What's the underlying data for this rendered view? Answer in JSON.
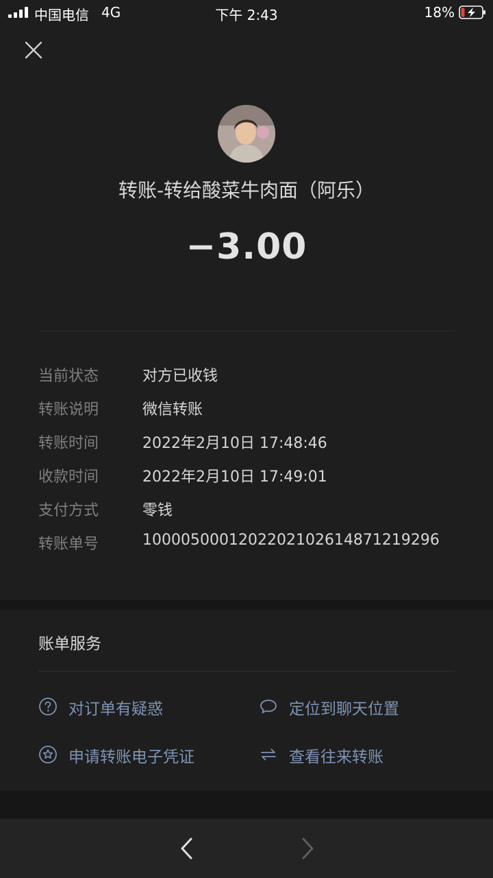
{
  "status_bar": {
    "carrier": "中国电信",
    "network": "4G",
    "time": "下午 2:43",
    "battery": "18%"
  },
  "header": {
    "close_icon": "close-icon",
    "title": "转账-转给酸菜牛肉面（阿乐）",
    "amount": "−3.00"
  },
  "details": [
    {
      "label": "当前状态",
      "value": "对方已收钱"
    },
    {
      "label": "转账说明",
      "value": "微信转账"
    },
    {
      "label": "转账时间",
      "value": "2022年2月10日 17:48:46"
    },
    {
      "label": "收款时间",
      "value": "2022年2月10日 17:49:01"
    },
    {
      "label": "支付方式",
      "value": "零钱"
    },
    {
      "label": "转账单号",
      "value": "100005000120220210261487121929 6"
    }
  ],
  "services": {
    "title": "账单服务",
    "items": [
      {
        "label": "对订单有疑惑",
        "icon": "question-icon"
      },
      {
        "label": "定位到聊天位置",
        "icon": "chat-bubble-icon"
      },
      {
        "label": "申请转账电子凭证",
        "icon": "star-icon"
      },
      {
        "label": "查看往来转账",
        "icon": "exchange-icon"
      }
    ]
  },
  "nav": {
    "back_icon": "chevron-left-icon",
    "forward_icon": "chevron-right-icon"
  },
  "colors": {
    "background": "#1e1e1e",
    "link": "#7f93b5",
    "muted": "#7f7f7f",
    "battery_low": "#e5413e"
  }
}
